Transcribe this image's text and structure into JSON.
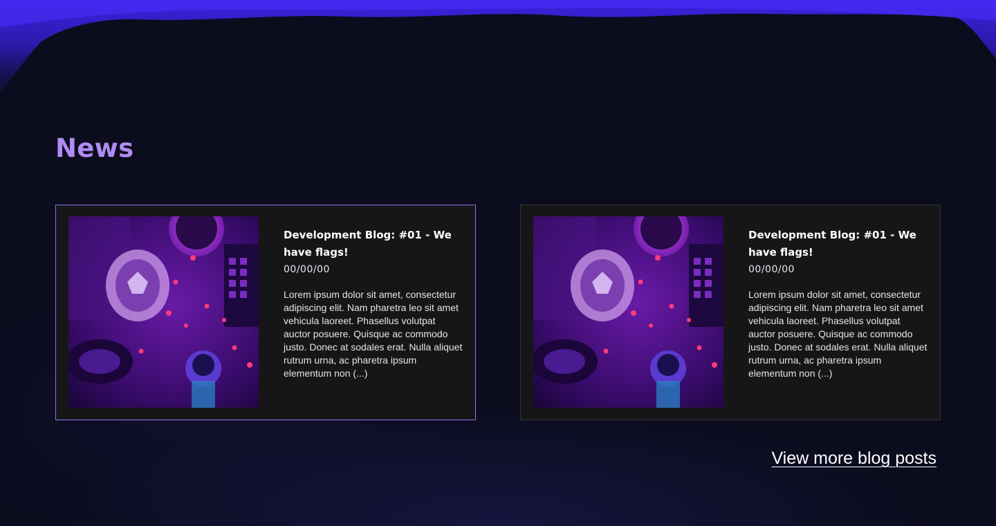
{
  "section": {
    "title": "News"
  },
  "posts": [
    {
      "title": "Development Blog: #01  - We have flags!",
      "date": "00/00/00",
      "excerpt": "Lorem ipsum dolor sit amet, consectetur adipiscing elit. Nam pharetra leo sit amet vehicula laoreet. Phasellus volutpat auctor posuere. Quisque ac commodo justo. Donec at sodales erat. Nulla aliquet rutrum urna, ac pharetra ipsum elementum non (...)"
    },
    {
      "title": "Development Blog: #01  - We have flags!",
      "date": "00/00/00",
      "excerpt": "Lorem ipsum dolor sit amet, consectetur adipiscing elit. Nam pharetra leo sit amet vehicula laoreet. Phasellus volutpat auctor posuere. Quisque ac commodo justo. Donec at sodales erat. Nulla aliquet rutrum urna, ac pharetra ipsum elementum non (...)"
    }
  ],
  "footer": {
    "view_more": "View more blog posts"
  },
  "colors": {
    "background": "#0b0c1d",
    "accent": "#b08cf2",
    "card": "#161618",
    "active_border": "#8f73e6"
  }
}
